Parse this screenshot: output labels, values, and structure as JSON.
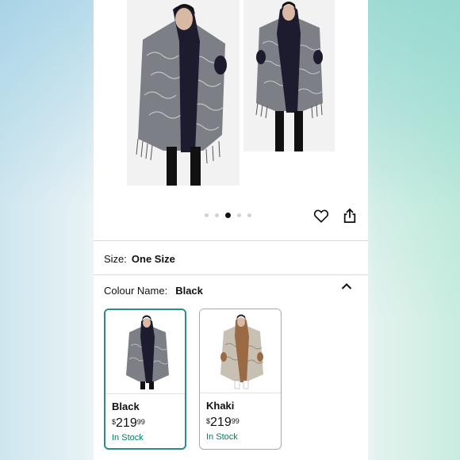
{
  "product_images": {
    "pagination": {
      "total": 5,
      "active_index": 2
    }
  },
  "actions": {
    "wishlist_icon": "heart-outline-icon",
    "share_icon": "share-icon"
  },
  "size": {
    "label": "Size:",
    "value": "One Size"
  },
  "colour": {
    "label": "Colour Name:",
    "value": "Black",
    "options": [
      {
        "name": "Black",
        "currency": "$",
        "price_whole": "219",
        "price_fraction": "99",
        "stock": "In Stock",
        "selected": true
      },
      {
        "name": "Khaki",
        "currency": "$",
        "price_whole": "219",
        "price_fraction": "99",
        "stock": "In Stock",
        "selected": false
      }
    ]
  },
  "colors": {
    "stock_green": "#067d62",
    "selected_border": "#2a8a8e"
  }
}
